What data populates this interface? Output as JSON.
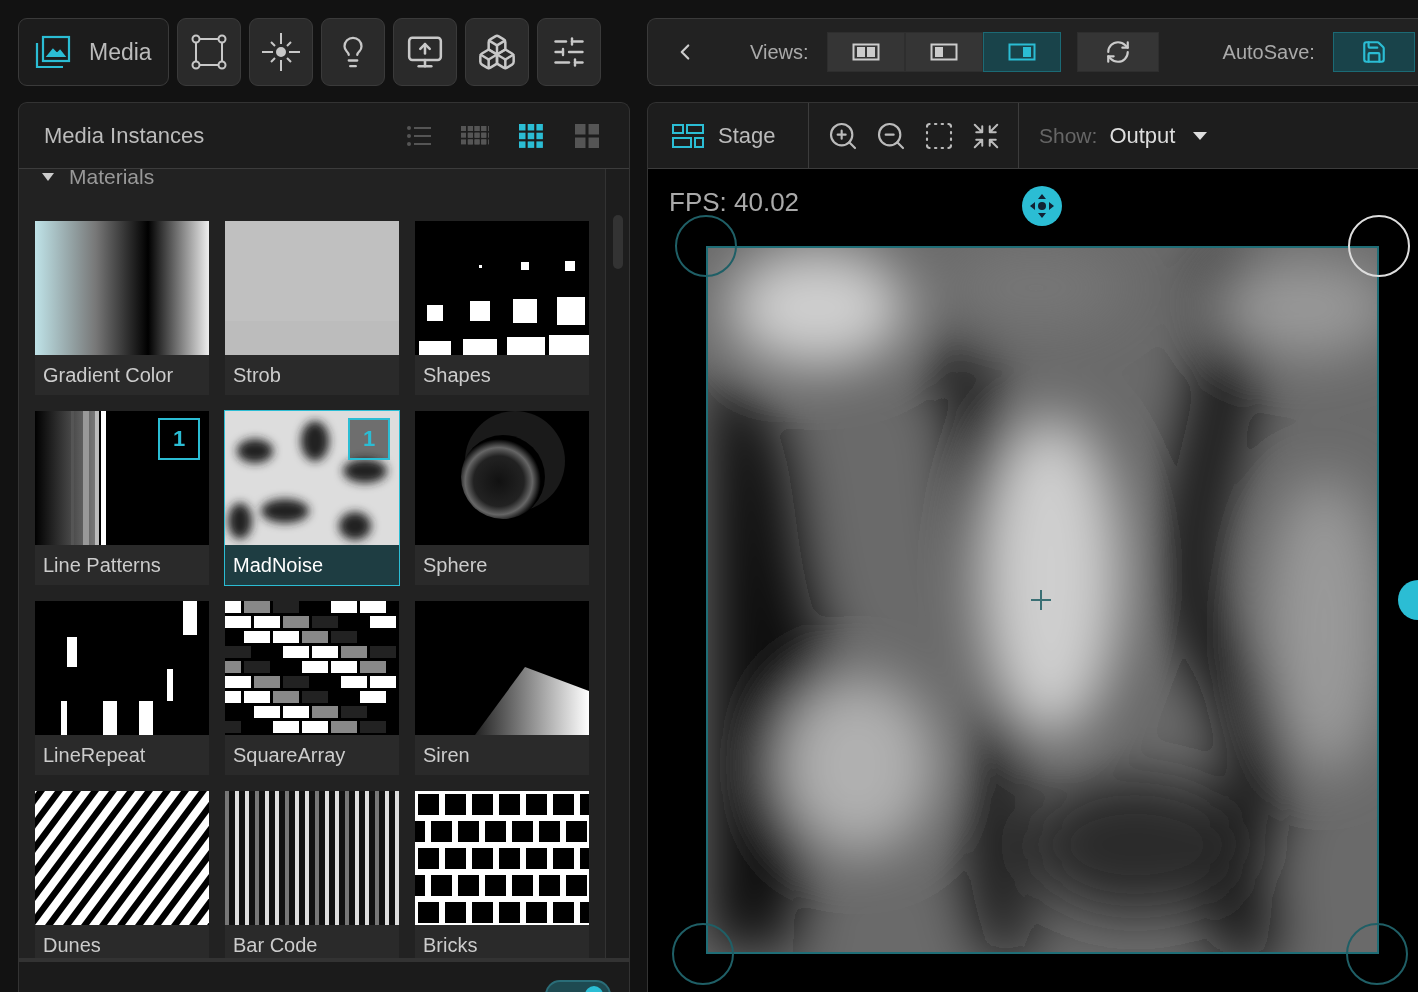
{
  "toolbar": {
    "media_button": {
      "label": "Media",
      "selected": true
    },
    "tools": [
      {
        "kind": "transform",
        "selected": false
      },
      {
        "kind": "light",
        "selected": false
      },
      {
        "kind": "idea",
        "selected": false
      },
      {
        "kind": "output",
        "selected": false
      },
      {
        "kind": "objects",
        "selected": false
      },
      {
        "kind": "settings",
        "selected": false
      }
    ]
  },
  "view_bar": {
    "views_label": "Views:",
    "views": [
      {
        "kind": "split",
        "selected": false
      },
      {
        "kind": "left",
        "selected": false
      },
      {
        "kind": "right",
        "selected": true
      }
    ],
    "autosave_label": "AutoSave:",
    "autosave": {
      "on": true
    }
  },
  "media_panel": {
    "title": "Media Instances",
    "view_modes": [
      {
        "kind": "list",
        "selected": false
      },
      {
        "kind": "small",
        "selected": false
      },
      {
        "kind": "medium",
        "selected": true
      },
      {
        "kind": "large",
        "selected": false
      }
    ],
    "section": {
      "label": "Materials",
      "expanded": true
    },
    "items": [
      {
        "label": "Gradient Color",
        "selected": false
      },
      {
        "label": "Strob",
        "selected": false
      },
      {
        "label": "Shapes",
        "selected": false
      },
      {
        "label": "Line Patterns",
        "selected": false,
        "badge": "1"
      },
      {
        "label": "MadNoise",
        "selected": true,
        "badge": "1"
      },
      {
        "label": "Sphere",
        "selected": false
      },
      {
        "label": "LineRepeat",
        "selected": false
      },
      {
        "label": "SquareArray",
        "selected": false
      },
      {
        "label": "Siren",
        "selected": false
      },
      {
        "label": "Dunes",
        "selected": false
      },
      {
        "label": "Bar Code",
        "selected": false
      },
      {
        "label": "Bricks",
        "selected": false
      }
    ]
  },
  "bottom_panel": {
    "preview_toggle": {
      "on": true
    }
  },
  "stage": {
    "tab": "Stage",
    "show_label": "Show:",
    "show_value": "Output",
    "fps": "FPS: 40.02"
  }
}
